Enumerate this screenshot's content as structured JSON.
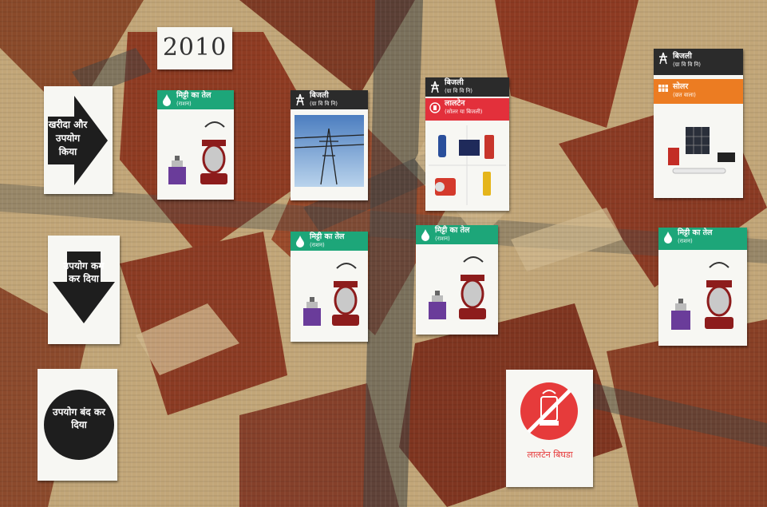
{
  "year_label": "2010",
  "legend": {
    "bought": "खरीदा और उपयोग किया",
    "reduced": "उपयोग कम कर दिया",
    "stopped": "उपयोग बंद कर दिया"
  },
  "cards": {
    "kerosene": {
      "title": "मिट्टी का तेल",
      "subtitle": "(राशन)"
    },
    "electricity": {
      "title": "बिजली",
      "subtitle": "(ग्रा वि वि नि)"
    },
    "lantern": {
      "title": "लालटेन",
      "subtitle": "(सोलर या बिजली)"
    },
    "solar": {
      "title": "सोलर",
      "subtitle": "(छत वाला)"
    },
    "lantern_broken": {
      "label": "लालटेन बिघडा"
    }
  },
  "colors": {
    "kerosene_header": "#1da679",
    "electricity_header": "#2b2b2b",
    "lantern_header": "#e3303b",
    "solar_header": "#ec7c22",
    "prohibition_red": "#e63b3b"
  }
}
